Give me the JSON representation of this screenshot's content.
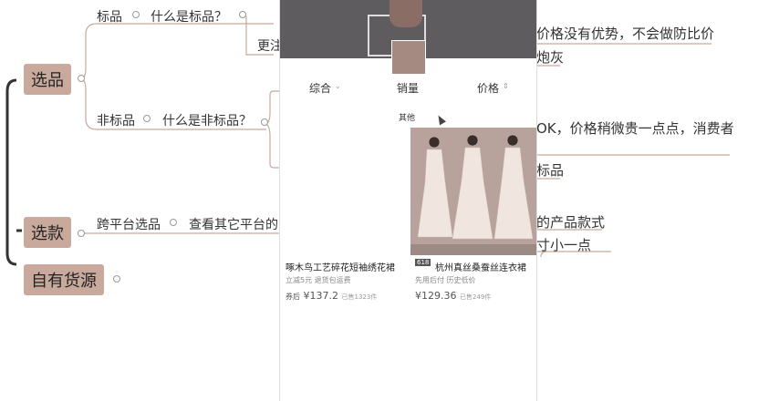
{
  "mindmap": {
    "branch_selection": "选品",
    "branch_styles": "选款",
    "branch_own_source": "自有货源",
    "standard_product": "标品",
    "what_is_standard": "什么是标品？",
    "more_note": "更注",
    "non_standard": "非标品",
    "what_is_non_standard": "什么是非标品？",
    "cross_platform": "跨平台选品",
    "view_other_platforms": "查看其它平台的",
    "note_price_no_advantage": "价格没有优势，不会做防比价",
    "note_burn": "炮灰",
    "note_ok_price": "OK，价格稍微贵一点点，消费者",
    "note_standard": "标品",
    "note_product_style": "的产品款式",
    "note_small": "寸小一点"
  },
  "phone": {
    "tabs": [
      "综合",
      "销量",
      "价格"
    ],
    "sub_tab": "其他",
    "products": [
      {
        "title": "啄木鸟工艺碎花短袖绣花裙",
        "meta": "立减5元  退货包运费",
        "price_prefix": "券后",
        "price": "¥137.2",
        "sales": "已售1323件"
      },
      {
        "title": "杭州真丝桑蚕丝连衣裙",
        "badge": "618",
        "meta": "先用后付  历史低价",
        "price": "¥129.36",
        "sales": "已售249件"
      }
    ]
  },
  "colors": {
    "node_bg": "#c9a99c",
    "bracket": "#333333",
    "phone_header": "#5e5c5f"
  }
}
